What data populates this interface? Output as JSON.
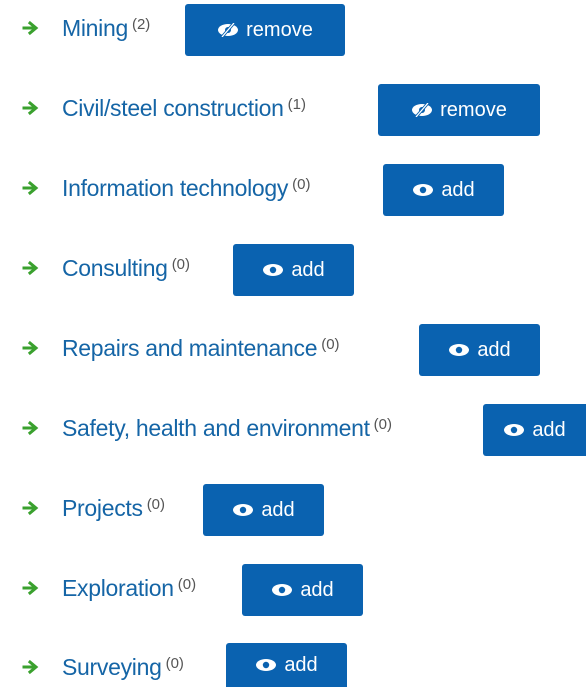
{
  "items": [
    {
      "label": "Mining",
      "count": "(2)",
      "action": "remove",
      "icon": "eye-slash-icon"
    },
    {
      "label": "Civil/steel construction",
      "count": "(1)",
      "action": "remove",
      "icon": "eye-slash-icon"
    },
    {
      "label": "Information technology",
      "count": "(0)",
      "action": "add",
      "icon": "eye-icon"
    },
    {
      "label": "Consulting",
      "count": "(0)",
      "action": "add",
      "icon": "eye-icon"
    },
    {
      "label": "Repairs and maintenance",
      "count": "(0)",
      "action": "add",
      "icon": "eye-icon"
    },
    {
      "label": "Safety, health and environment",
      "count": "(0)",
      "action": "add",
      "icon": "eye-icon"
    },
    {
      "label": "Projects",
      "count": "(0)",
      "action": "add",
      "icon": "eye-icon"
    },
    {
      "label": "Exploration",
      "count": "(0)",
      "action": "add",
      "icon": "eye-icon"
    },
    {
      "label": "Surveying",
      "count": "(0)",
      "action": "add",
      "icon": "eye-icon"
    }
  ],
  "colors": {
    "link": "#1565a6",
    "button": "#0a62b0",
    "arrow": "#3aa12e"
  }
}
